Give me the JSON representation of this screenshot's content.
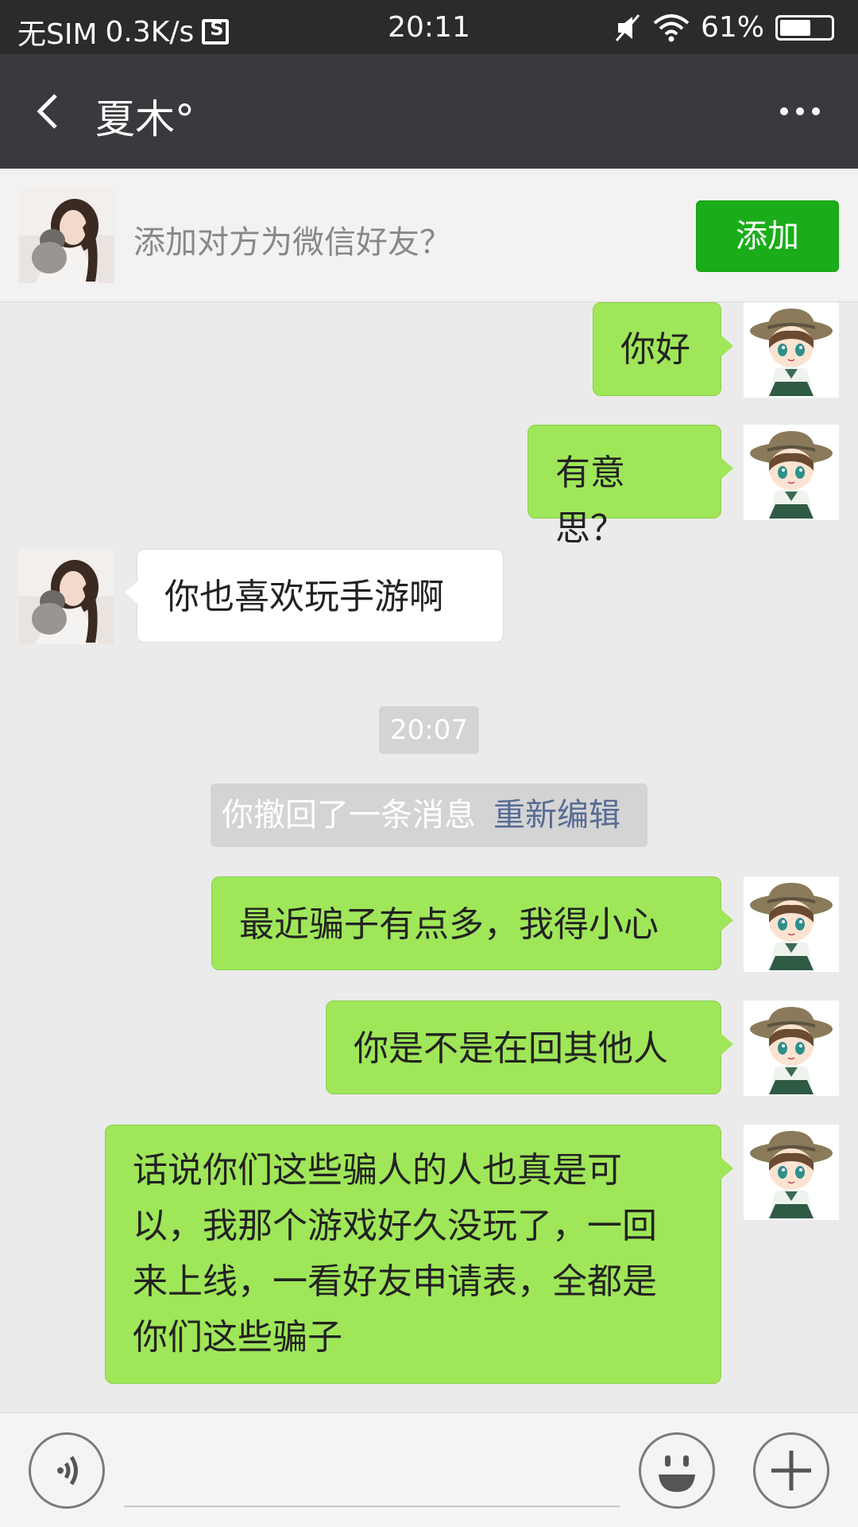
{
  "status_bar": {
    "carrier": "无SIM",
    "speed": "0.3K/s",
    "time": "20:11",
    "battery": "61%",
    "battery_level": 0.61
  },
  "header": {
    "title": "夏木°",
    "back_icon": "back-arrow-icon",
    "more_icon": "more-dots-icon"
  },
  "banner": {
    "text": "添加对方为微信好友？",
    "add_label": "添加"
  },
  "messages": [
    {
      "from": "me",
      "text": "你好"
    },
    {
      "from": "me",
      "text": "有意思？"
    },
    {
      "from": "them",
      "text": "你也喜欢玩手游啊"
    },
    {
      "type": "time",
      "text": "20:07"
    },
    {
      "type": "recall",
      "text": "你撤回了一条消息",
      "action": "重新编辑"
    },
    {
      "from": "me",
      "text": "最近骗子有点多，我得小心"
    },
    {
      "from": "me",
      "text": "你是不是在回其他人"
    },
    {
      "from": "me",
      "lines": [
        "话说你们这些骗人的人也真是可",
        "以，我那个游戏好久没玩了，一回",
        "来上线，一看好友申请表，全都是",
        "你们这些骗子"
      ]
    }
  ],
  "input_bar": {
    "voice_icon": "voice-icon",
    "emoji_icon": "emoji-icon",
    "plus_icon": "plus-icon",
    "placeholder": ""
  },
  "colors": {
    "my_bubble": "#9fe658",
    "their_bubble": "#ffffff",
    "add_button": "#1aad19",
    "link": "#576b95",
    "header_bg": "#393a3e"
  }
}
